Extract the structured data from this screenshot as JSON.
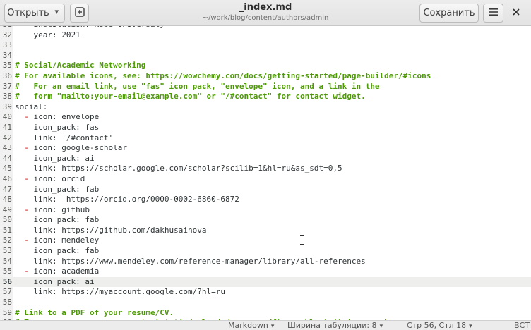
{
  "header": {
    "open_label": "Открыть",
    "open_chevron": "▾",
    "new_tab_icon": "⊞",
    "title": "_index.md",
    "subtitle": "~/work/blog/content/authors/admin",
    "save_label": "Сохранить",
    "menu_icon": "☰",
    "close_icon": "✕"
  },
  "editor": {
    "current_line": 56,
    "lines": [
      {
        "n": "31",
        "segments": [
          {
            "t": "    institution: Kobe University",
            "c": ""
          }
        ]
      },
      {
        "n": "32",
        "segments": [
          {
            "t": "    year: 2021",
            "c": ""
          }
        ]
      },
      {
        "n": "33",
        "segments": [
          {
            "t": "",
            "c": ""
          }
        ]
      },
      {
        "n": "34",
        "segments": [
          {
            "t": "",
            "c": ""
          }
        ]
      },
      {
        "n": "35",
        "segments": [
          {
            "t": "# Social/Academic Networking",
            "c": "cmt"
          }
        ]
      },
      {
        "n": "36",
        "segments": [
          {
            "t": "# For available icons, see: https://wowchemy.com/docs/getting-started/page-builder/#icons",
            "c": "cmt"
          }
        ]
      },
      {
        "n": "37",
        "segments": [
          {
            "t": "#   For an email link, use \"fas\" icon pack, \"envelope\" icon, and a link in the",
            "c": "cmt"
          }
        ]
      },
      {
        "n": "38",
        "segments": [
          {
            "t": "#   form \"mailto:your-email@example.com\" or \"/#contact\" for contact widget.",
            "c": "cmt"
          }
        ]
      },
      {
        "n": "39",
        "segments": [
          {
            "t": "social:",
            "c": ""
          }
        ]
      },
      {
        "n": "40",
        "segments": [
          {
            "t": "  ",
            "c": ""
          },
          {
            "t": "-",
            "c": "dash"
          },
          {
            "t": " icon: envelope",
            "c": ""
          }
        ]
      },
      {
        "n": "41",
        "segments": [
          {
            "t": "    icon_pack: fas",
            "c": ""
          }
        ]
      },
      {
        "n": "42",
        "segments": [
          {
            "t": "    link: '/#contact'",
            "c": ""
          }
        ]
      },
      {
        "n": "43",
        "segments": [
          {
            "t": "  ",
            "c": ""
          },
          {
            "t": "-",
            "c": "dash"
          },
          {
            "t": " icon: google-scholar",
            "c": ""
          }
        ]
      },
      {
        "n": "44",
        "segments": [
          {
            "t": "    icon_pack: ai",
            "c": ""
          }
        ]
      },
      {
        "n": "45",
        "segments": [
          {
            "t": "    link: https://scholar.google.com/scholar?scilib=1&hl=ru&as_sdt=0,5",
            "c": ""
          }
        ]
      },
      {
        "n": "46",
        "segments": [
          {
            "t": "  ",
            "c": ""
          },
          {
            "t": "-",
            "c": "dash"
          },
          {
            "t": " icon: orcid",
            "c": ""
          }
        ]
      },
      {
        "n": "47",
        "segments": [
          {
            "t": "    icon_pack: fab",
            "c": ""
          }
        ]
      },
      {
        "n": "48",
        "segments": [
          {
            "t": "    link:  https://orcid.org/0000-0002-6860-6872",
            "c": ""
          }
        ]
      },
      {
        "n": "49",
        "segments": [
          {
            "t": "  ",
            "c": ""
          },
          {
            "t": "-",
            "c": "dash"
          },
          {
            "t": " icon: github",
            "c": ""
          }
        ]
      },
      {
        "n": "50",
        "segments": [
          {
            "t": "    icon_pack: fab",
            "c": ""
          }
        ]
      },
      {
        "n": "51",
        "segments": [
          {
            "t": "    link: https://github.com/dakhusainova",
            "c": ""
          }
        ]
      },
      {
        "n": "52",
        "segments": [
          {
            "t": "  ",
            "c": ""
          },
          {
            "t": "-",
            "c": "dash"
          },
          {
            "t": " icon: mendeley",
            "c": ""
          }
        ]
      },
      {
        "n": "53",
        "segments": [
          {
            "t": "    icon_pack: fab",
            "c": ""
          }
        ]
      },
      {
        "n": "54",
        "segments": [
          {
            "t": "    link: https://www.mendeley.com/reference-manager/library/all-references",
            "c": ""
          }
        ]
      },
      {
        "n": "55",
        "segments": [
          {
            "t": "  ",
            "c": ""
          },
          {
            "t": "-",
            "c": "dash"
          },
          {
            "t": " icon: academia",
            "c": ""
          }
        ]
      },
      {
        "n": "56",
        "segments": [
          {
            "t": "    icon_pack: ai",
            "c": ""
          }
        ]
      },
      {
        "n": "57",
        "segments": [
          {
            "t": "    link: https://myaccount.google.com/?hl=ru",
            "c": ""
          }
        ]
      },
      {
        "n": "58",
        "segments": [
          {
            "t": "",
            "c": ""
          }
        ]
      },
      {
        "n": "59",
        "segments": [
          {
            "t": "# Link to a PDF of your resume/CV.",
            "c": "cmt"
          }
        ]
      },
      {
        "n": "60",
        "segments": [
          {
            "t": "# To use: copy your resume to `static/uploads/resume.pdf`, enable `ai` icon pack",
            "c": "cmt"
          }
        ]
      }
    ]
  },
  "statusbar": {
    "language": "Markdown",
    "tab_width": "Ширина табуляции: 8",
    "position": "Стр 56, Стл 18",
    "mode": "ВСТ",
    "chevron": "▾"
  },
  "colors": {
    "comment": "#4e9a06",
    "dash": "#cc0000",
    "current_line": "#eeeeec"
  }
}
